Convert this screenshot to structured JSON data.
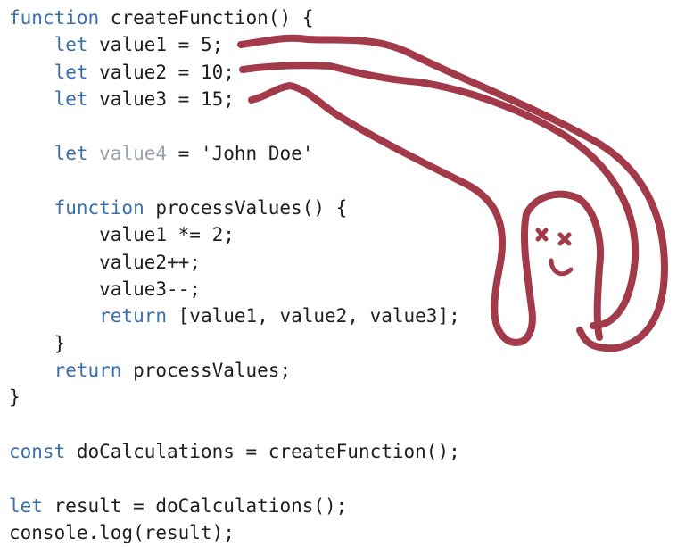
{
  "code": {
    "lines": [
      {
        "kw": "function",
        "text": " createFunction() {"
      },
      {
        "kw": "    let",
        "text": " value1 = 5;"
      },
      {
        "kw": "    let",
        "text": " value2 = 10;"
      },
      {
        "kw": "    let",
        "text": " value3 = 15;"
      },
      {
        "kw": "",
        "text": ""
      },
      {
        "kw": "    let",
        "dim": " value4",
        "text": " = 'John Doe'"
      },
      {
        "kw": "",
        "text": ""
      },
      {
        "kw": "    function",
        "text": " processValues() {"
      },
      {
        "kw": "",
        "text": "        value1 *= 2;"
      },
      {
        "kw": "",
        "text": "        value2++;"
      },
      {
        "kw": "",
        "text": "        value3--;"
      },
      {
        "kw": "        return",
        "text": " [value1, value2, value3];"
      },
      {
        "kw": "",
        "text": "    }"
      },
      {
        "kw": "    return",
        "text": " processValues;"
      },
      {
        "kw": "",
        "text": "}"
      },
      {
        "kw": "",
        "text": ""
      },
      {
        "kw": "const",
        "text": " doCalculations = createFunction();"
      },
      {
        "kw": "",
        "text": ""
      },
      {
        "kw": "let",
        "text": " result = doCalculations();"
      },
      {
        "kw": "",
        "text": "console.log(result);"
      }
    ]
  },
  "annotation": {
    "color": "#a33a4a",
    "description_icon": "closure-ghost-drawing"
  }
}
